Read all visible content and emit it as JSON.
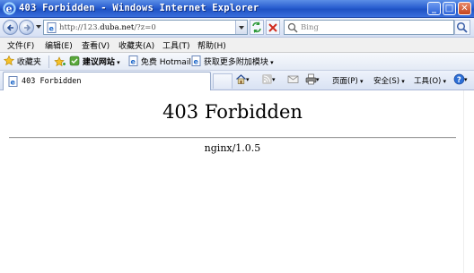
{
  "window": {
    "title": "403 Forbidden - Windows Internet Explorer",
    "controls": {
      "minimize": "_",
      "maximize": "□",
      "close": "✕"
    }
  },
  "address": {
    "url_prefix": "http://123.",
    "url_domain": "duba.net",
    "url_suffix": "/?z=0",
    "search_placeholder": "Bing"
  },
  "menu": [
    "文件(F)",
    "编辑(E)",
    "查看(V)",
    "收藏夹(A)",
    "工具(T)",
    "帮助(H)"
  ],
  "favorites": {
    "label": "收藏夹",
    "items": [
      {
        "label": "建议网站",
        "icon": "suggest-sites-icon"
      },
      {
        "label": "免费 Hotmail",
        "icon": "page-icon"
      },
      {
        "label": "获取更多附加模块",
        "icon": "page-icon"
      }
    ]
  },
  "tab": {
    "label": "403 Forbidden"
  },
  "commands": {
    "page": "页面(P)",
    "safety": "安全(S)",
    "tools": "工具(O)"
  },
  "page": {
    "heading": "403 Forbidden",
    "server": "nginx/1.0.5"
  },
  "colors": {
    "titlebar": "#2a5fd0",
    "toolbar": "#e4eaf5",
    "menubar": "#f0f0f0"
  }
}
